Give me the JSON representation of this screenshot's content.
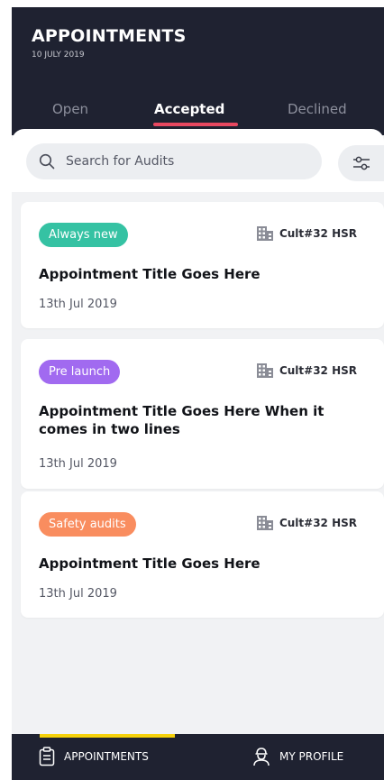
{
  "header": {
    "title": "APPOINTMENTS",
    "date": "10 JULY 2019"
  },
  "tabs": [
    {
      "label": "Open",
      "active": false
    },
    {
      "label": "Accepted",
      "active": true
    },
    {
      "label": "Declined",
      "active": false
    }
  ],
  "search": {
    "placeholder": "Search for Audits"
  },
  "cards": [
    {
      "tag": "Always new",
      "tag_color": "#35c2a3",
      "location": "Cult#32 HSR",
      "title": "Appointment Title Goes Here",
      "date": "13th Jul 2019"
    },
    {
      "tag": "Pre launch",
      "tag_color": "#a16af0",
      "location": "Cult#32 HSR",
      "title": "Appointment Title Goes Here When it comes in two lines",
      "date": "13th Jul 2019"
    },
    {
      "tag": "Safety audits",
      "tag_color": "#f98d5f",
      "location": "Cult#32 HSR",
      "title": "Appointment Title Goes Here",
      "date": "13th Jul 2019"
    }
  ],
  "bottom_nav": {
    "appointments": "APPOINTMENTS",
    "profile": "MY PROFILE",
    "active": "APPOINTMENTS"
  },
  "colors": {
    "header_bg": "#1f2231",
    "tab_indicator": "#e84860",
    "nav_indicator": "#f5d10a"
  },
  "icons": [
    "search-icon",
    "filter-icon",
    "building-icon",
    "clipboard-icon",
    "profile-icon"
  ]
}
